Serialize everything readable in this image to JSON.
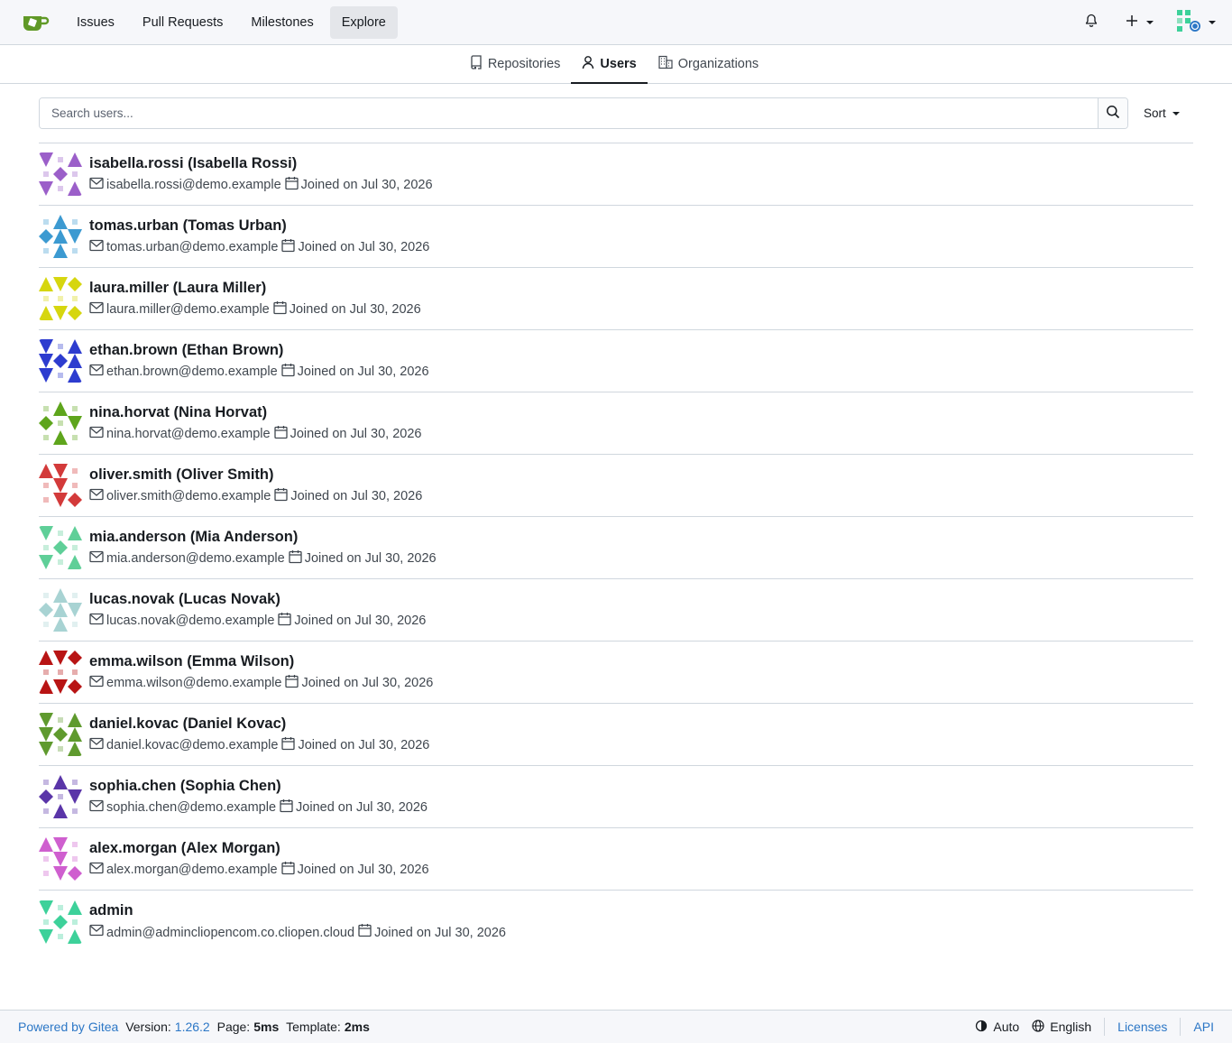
{
  "navbar": {
    "items": [
      {
        "label": "Issues"
      },
      {
        "label": "Pull Requests"
      },
      {
        "label": "Milestones"
      },
      {
        "label": "Explore"
      }
    ],
    "icons": [
      "gitea-logo-icon",
      "bell-icon",
      "plus-icon",
      "user-avatar"
    ]
  },
  "subnav": {
    "tabs": [
      {
        "label": "Repositories",
        "icon": "repo-icon"
      },
      {
        "label": "Users",
        "icon": "person-icon",
        "active": true
      },
      {
        "label": "Organizations",
        "icon": "organization-icon"
      }
    ]
  },
  "search": {
    "placeholder": "Search users...",
    "value": "",
    "sort_label": "Sort"
  },
  "users": [
    {
      "name": "isabella.rossi (Isabella Rossi)",
      "email": "isabella.rossi@demo.example",
      "joined": "Joined on Jul 30, 2026",
      "color": "#9b5fc9"
    },
    {
      "name": "tomas.urban (Tomas Urban)",
      "email": "tomas.urban@demo.example",
      "joined": "Joined on Jul 30, 2026",
      "color": "#3c9ad1"
    },
    {
      "name": "laura.miller (Laura Miller)",
      "email": "laura.miller@demo.example",
      "joined": "Joined on Jul 30, 2026",
      "color": "#d6d60f"
    },
    {
      "name": "ethan.brown (Ethan Brown)",
      "email": "ethan.brown@demo.example",
      "joined": "Joined on Jul 30, 2026",
      "color": "#2d3ccf"
    },
    {
      "name": "nina.horvat (Nina Horvat)",
      "email": "nina.horvat@demo.example",
      "joined": "Joined on Jul 30, 2026",
      "color": "#5ea51c"
    },
    {
      "name": "oliver.smith (Oliver Smith)",
      "email": "oliver.smith@demo.example",
      "joined": "Joined on Jul 30, 2026",
      "color": "#d33a3a"
    },
    {
      "name": "mia.anderson (Mia Anderson)",
      "email": "mia.anderson@demo.example",
      "joined": "Joined on Jul 30, 2026",
      "color": "#5fcf98"
    },
    {
      "name": "lucas.novak (Lucas Novak)",
      "email": "lucas.novak@demo.example",
      "joined": "Joined on Jul 30, 2026",
      "color": "#a8d3d3"
    },
    {
      "name": "emma.wilson (Emma Wilson)",
      "email": "emma.wilson@demo.example",
      "joined": "Joined on Jul 30, 2026",
      "color": "#b81414"
    },
    {
      "name": "daniel.kovac (Daniel Kovac)",
      "email": "daniel.kovac@demo.example",
      "joined": "Joined on Jul 30, 2026",
      "color": "#5f9a2e"
    },
    {
      "name": "sophia.chen (Sophia Chen)",
      "email": "sophia.chen@demo.example",
      "joined": "Joined on Jul 30, 2026",
      "color": "#5a35a8"
    },
    {
      "name": "alex.morgan (Alex Morgan)",
      "email": "alex.morgan@demo.example",
      "joined": "Joined on Jul 30, 2026",
      "color": "#cf5fcf"
    },
    {
      "name": "admin",
      "email": "admin@admincliopencom.co.cliopen.cloud",
      "joined": "Joined on Jul 30, 2026",
      "color": "#3dd19a"
    }
  ],
  "footer": {
    "powered_by": "Powered by Gitea",
    "version_label": "Version:",
    "version": "1.26.2",
    "page_label": "Page:",
    "page_time": "5ms",
    "template_label": "Template:",
    "template_time": "2ms",
    "theme": "Auto",
    "language": "English",
    "licenses": "Licenses",
    "api": "API"
  },
  "colors": {
    "accent": "#2c77c6",
    "border": "#d0d7de",
    "navbar_bg": "#f6f7fa",
    "logo_green": "#609926"
  }
}
